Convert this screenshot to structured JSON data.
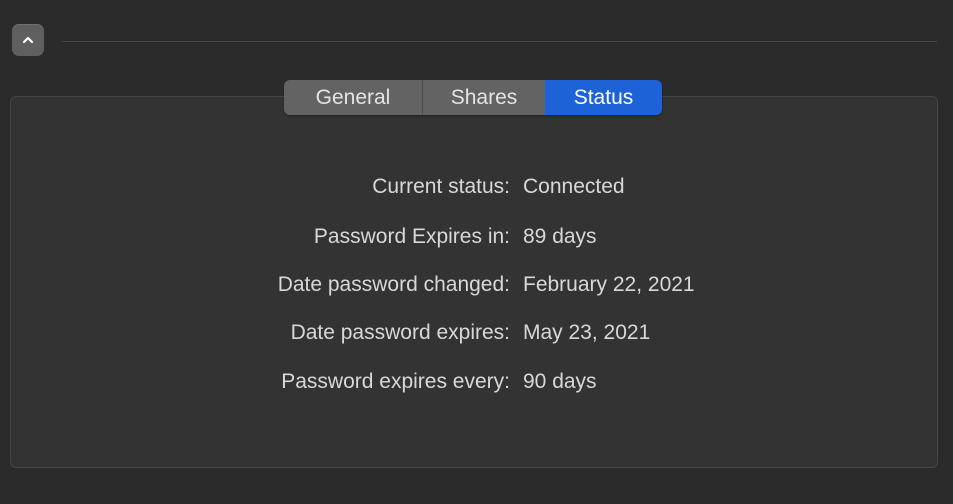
{
  "header": {
    "collapse_icon": "chevron-up-icon"
  },
  "tabs": [
    {
      "label": "General",
      "selected": false
    },
    {
      "label": "Shares",
      "selected": false
    },
    {
      "label": "Status",
      "selected": true
    }
  ],
  "status": {
    "rows": [
      {
        "label": "Current status:",
        "value": "Connected"
      },
      {
        "label": "Password Expires in:",
        "value": "89 days"
      },
      {
        "label": "Date password changed:",
        "value": "February 22, 2021"
      },
      {
        "label": "Date password expires:",
        "value": "May 23, 2021"
      },
      {
        "label": "Password expires every:",
        "value": "90 days"
      }
    ]
  },
  "colors": {
    "window_bg": "#2b2b2b",
    "panel_bg": "#333333",
    "tab_bg": "#636363",
    "accent": "#1d62d6",
    "text": "#d8d8d8"
  }
}
